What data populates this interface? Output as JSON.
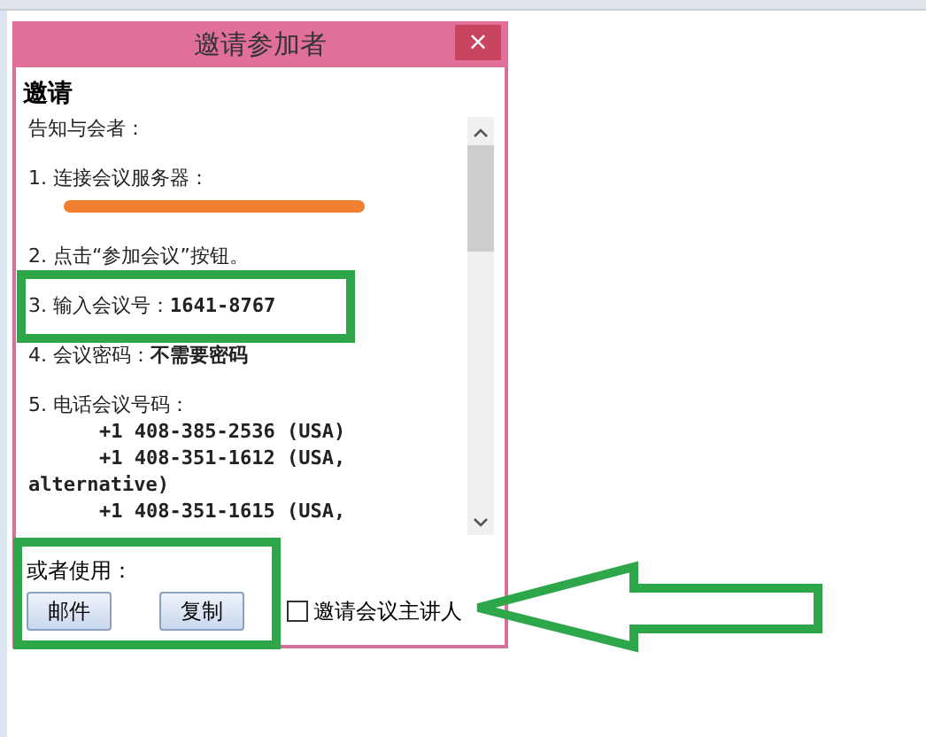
{
  "dialog": {
    "title": "邀请参加者",
    "close": "×",
    "heading": "邀请",
    "lines": [
      {
        "kind": "intro",
        "text": "告知与会者："
      },
      {
        "kind": "item",
        "text": "1. 连接会议服务器："
      },
      {
        "kind": "redacted"
      },
      {
        "kind": "item",
        "text": "2. 点击“参加会议”按钮。"
      },
      {
        "kind": "item",
        "text": "3. 输入会议号：**1641-8767**"
      },
      {
        "kind": "item",
        "text": "4. 会议密码：**不需要密码**"
      },
      {
        "kind": "item",
        "text": "5. 电话会议号码："
      },
      {
        "kind": "phone",
        "text": "+1 408-385-2536 (USA)"
      },
      {
        "kind": "phone",
        "text": "+1 408-351-1612 (USA,"
      },
      {
        "kind": "wrap",
        "text": "alternative)"
      },
      {
        "kind": "phone",
        "text": "+1 408-351-1615 (USA,"
      }
    ],
    "footer_label": "或者使用：",
    "buttons": [
      "邮件",
      "复制"
    ],
    "checkbox": {
      "label": "邀请会议主讲人",
      "checked": false
    }
  }
}
